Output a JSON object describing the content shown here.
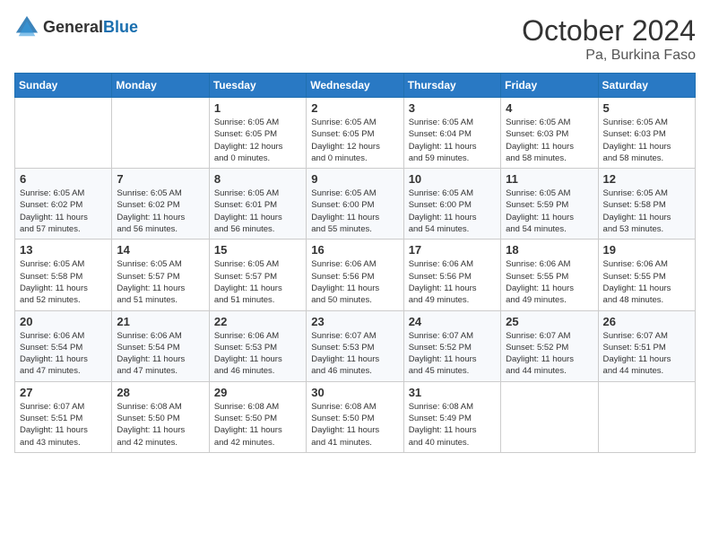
{
  "header": {
    "logo_general": "General",
    "logo_blue": "Blue",
    "month_title": "October 2024",
    "location": "Pa, Burkina Faso"
  },
  "days_of_week": [
    "Sunday",
    "Monday",
    "Tuesday",
    "Wednesday",
    "Thursday",
    "Friday",
    "Saturday"
  ],
  "weeks": [
    [
      {
        "day": "",
        "info": ""
      },
      {
        "day": "",
        "info": ""
      },
      {
        "day": "1",
        "info": "Sunrise: 6:05 AM\nSunset: 6:05 PM\nDaylight: 12 hours\nand 0 minutes."
      },
      {
        "day": "2",
        "info": "Sunrise: 6:05 AM\nSunset: 6:05 PM\nDaylight: 12 hours\nand 0 minutes."
      },
      {
        "day": "3",
        "info": "Sunrise: 6:05 AM\nSunset: 6:04 PM\nDaylight: 11 hours\nand 59 minutes."
      },
      {
        "day": "4",
        "info": "Sunrise: 6:05 AM\nSunset: 6:03 PM\nDaylight: 11 hours\nand 58 minutes."
      },
      {
        "day": "5",
        "info": "Sunrise: 6:05 AM\nSunset: 6:03 PM\nDaylight: 11 hours\nand 58 minutes."
      }
    ],
    [
      {
        "day": "6",
        "info": "Sunrise: 6:05 AM\nSunset: 6:02 PM\nDaylight: 11 hours\nand 57 minutes."
      },
      {
        "day": "7",
        "info": "Sunrise: 6:05 AM\nSunset: 6:02 PM\nDaylight: 11 hours\nand 56 minutes."
      },
      {
        "day": "8",
        "info": "Sunrise: 6:05 AM\nSunset: 6:01 PM\nDaylight: 11 hours\nand 56 minutes."
      },
      {
        "day": "9",
        "info": "Sunrise: 6:05 AM\nSunset: 6:00 PM\nDaylight: 11 hours\nand 55 minutes."
      },
      {
        "day": "10",
        "info": "Sunrise: 6:05 AM\nSunset: 6:00 PM\nDaylight: 11 hours\nand 54 minutes."
      },
      {
        "day": "11",
        "info": "Sunrise: 6:05 AM\nSunset: 5:59 PM\nDaylight: 11 hours\nand 54 minutes."
      },
      {
        "day": "12",
        "info": "Sunrise: 6:05 AM\nSunset: 5:58 PM\nDaylight: 11 hours\nand 53 minutes."
      }
    ],
    [
      {
        "day": "13",
        "info": "Sunrise: 6:05 AM\nSunset: 5:58 PM\nDaylight: 11 hours\nand 52 minutes."
      },
      {
        "day": "14",
        "info": "Sunrise: 6:05 AM\nSunset: 5:57 PM\nDaylight: 11 hours\nand 51 minutes."
      },
      {
        "day": "15",
        "info": "Sunrise: 6:05 AM\nSunset: 5:57 PM\nDaylight: 11 hours\nand 51 minutes."
      },
      {
        "day": "16",
        "info": "Sunrise: 6:06 AM\nSunset: 5:56 PM\nDaylight: 11 hours\nand 50 minutes."
      },
      {
        "day": "17",
        "info": "Sunrise: 6:06 AM\nSunset: 5:56 PM\nDaylight: 11 hours\nand 49 minutes."
      },
      {
        "day": "18",
        "info": "Sunrise: 6:06 AM\nSunset: 5:55 PM\nDaylight: 11 hours\nand 49 minutes."
      },
      {
        "day": "19",
        "info": "Sunrise: 6:06 AM\nSunset: 5:55 PM\nDaylight: 11 hours\nand 48 minutes."
      }
    ],
    [
      {
        "day": "20",
        "info": "Sunrise: 6:06 AM\nSunset: 5:54 PM\nDaylight: 11 hours\nand 47 minutes."
      },
      {
        "day": "21",
        "info": "Sunrise: 6:06 AM\nSunset: 5:54 PM\nDaylight: 11 hours\nand 47 minutes."
      },
      {
        "day": "22",
        "info": "Sunrise: 6:06 AM\nSunset: 5:53 PM\nDaylight: 11 hours\nand 46 minutes."
      },
      {
        "day": "23",
        "info": "Sunrise: 6:07 AM\nSunset: 5:53 PM\nDaylight: 11 hours\nand 46 minutes."
      },
      {
        "day": "24",
        "info": "Sunrise: 6:07 AM\nSunset: 5:52 PM\nDaylight: 11 hours\nand 45 minutes."
      },
      {
        "day": "25",
        "info": "Sunrise: 6:07 AM\nSunset: 5:52 PM\nDaylight: 11 hours\nand 44 minutes."
      },
      {
        "day": "26",
        "info": "Sunrise: 6:07 AM\nSunset: 5:51 PM\nDaylight: 11 hours\nand 44 minutes."
      }
    ],
    [
      {
        "day": "27",
        "info": "Sunrise: 6:07 AM\nSunset: 5:51 PM\nDaylight: 11 hours\nand 43 minutes."
      },
      {
        "day": "28",
        "info": "Sunrise: 6:08 AM\nSunset: 5:50 PM\nDaylight: 11 hours\nand 42 minutes."
      },
      {
        "day": "29",
        "info": "Sunrise: 6:08 AM\nSunset: 5:50 PM\nDaylight: 11 hours\nand 42 minutes."
      },
      {
        "day": "30",
        "info": "Sunrise: 6:08 AM\nSunset: 5:50 PM\nDaylight: 11 hours\nand 41 minutes."
      },
      {
        "day": "31",
        "info": "Sunrise: 6:08 AM\nSunset: 5:49 PM\nDaylight: 11 hours\nand 40 minutes."
      },
      {
        "day": "",
        "info": ""
      },
      {
        "day": "",
        "info": ""
      }
    ]
  ]
}
